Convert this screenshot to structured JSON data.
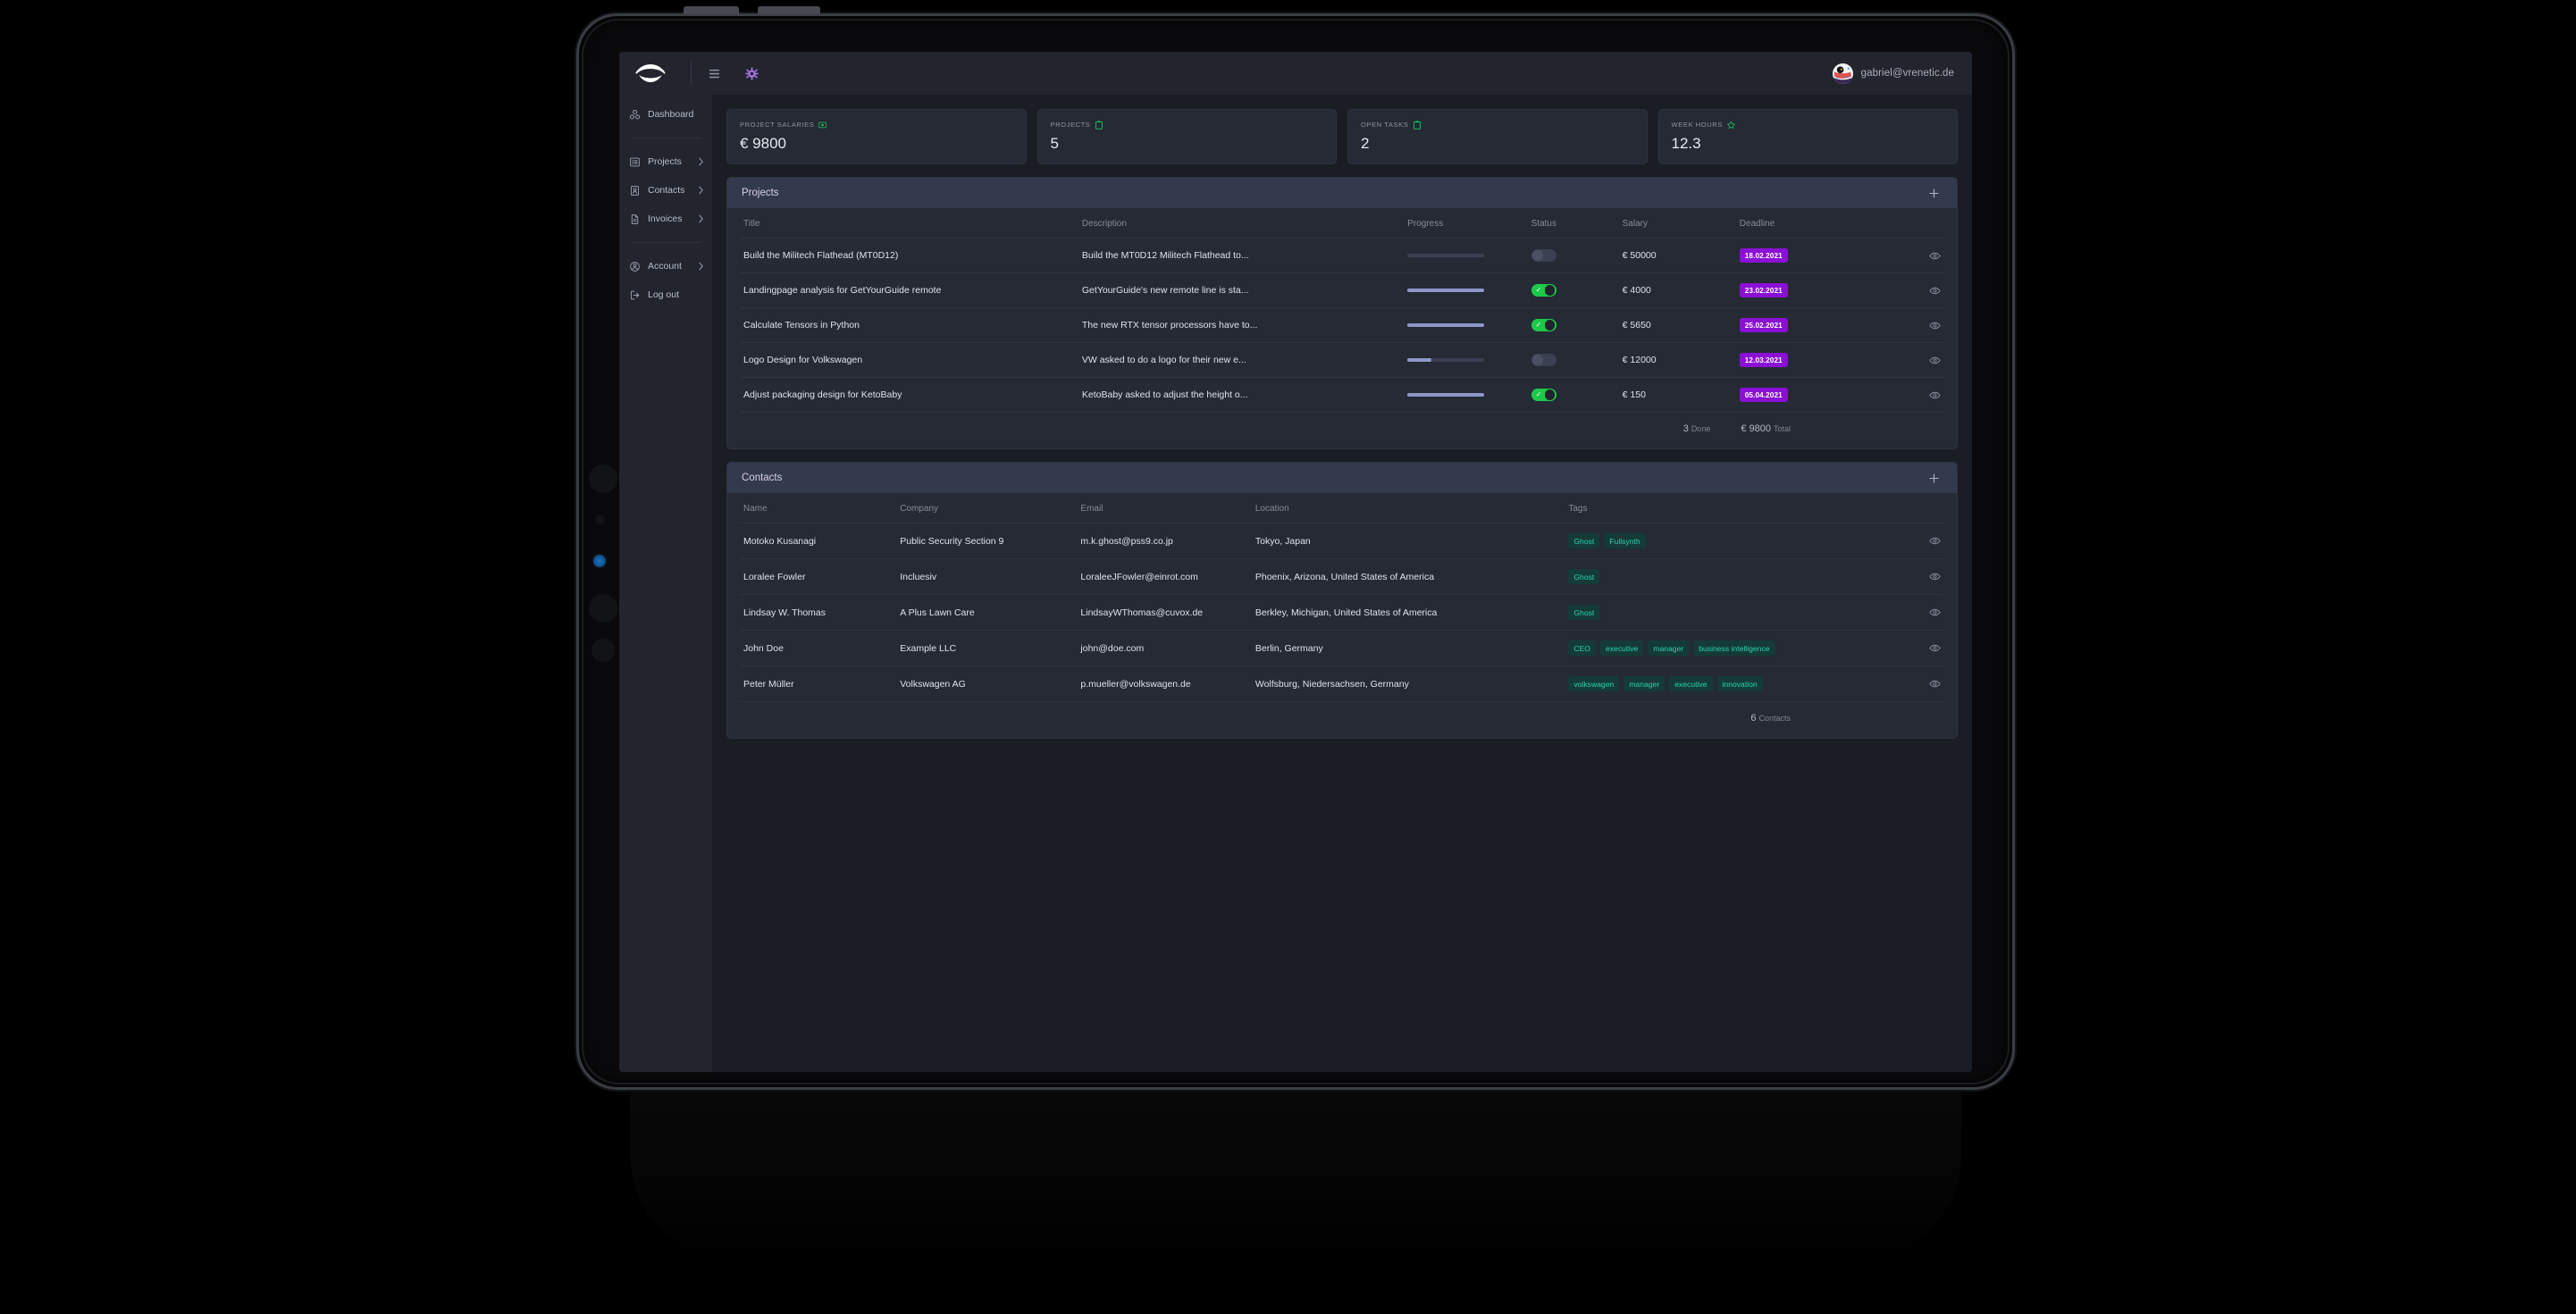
{
  "topbar": {
    "logo_icon": "eye-lens-logo",
    "menu_icon": "hamburger-menu-icon",
    "settings_icon": "gear-icon",
    "user_email": "gabriel@vrenetic.de",
    "avatar_icon": "user-avatar"
  },
  "sidebar": {
    "groups": [
      {
        "items": [
          {
            "label": "Dashboard",
            "icon": "dashboard-icon",
            "chevron": false
          }
        ]
      },
      {
        "items": [
          {
            "label": "Projects",
            "icon": "list-icon",
            "chevron": true
          },
          {
            "label": "Contacts",
            "icon": "contact-card-icon",
            "chevron": true
          },
          {
            "label": "Invoices",
            "icon": "document-icon",
            "chevron": true
          }
        ]
      },
      {
        "items": [
          {
            "label": "Account",
            "icon": "account-circle-icon",
            "chevron": true
          },
          {
            "label": "Log out",
            "icon": "logout-icon",
            "chevron": false
          }
        ]
      }
    ]
  },
  "stats": [
    {
      "label": "PROJECT SALARIES",
      "icon": "money-icon",
      "value": "€ 9800"
    },
    {
      "label": "PROJECTS",
      "icon": "clipboard-icon",
      "value": "5"
    },
    {
      "label": "OPEN TASKS",
      "icon": "clipboard-icon",
      "value": "2"
    },
    {
      "label": "WEEK HOURS",
      "icon": "star-icon",
      "value": "12.3"
    }
  ],
  "projects_panel": {
    "title": "Projects",
    "add_label": "+",
    "columns": [
      "Title",
      "Description",
      "Progress",
      "Status",
      "Salary",
      "Deadline",
      ""
    ],
    "rows": [
      {
        "title": "Build the Militech Flathead (MT0D12)",
        "description": "Build the MT0D12 Militech Flathead to...",
        "progress": 0,
        "status": false,
        "salary": "€ 50000",
        "deadline": "18.02.2021",
        "action_icon": "eye-icon"
      },
      {
        "title": "Landingpage analysis for GetYourGuide remote",
        "description": "GetYourGuide's new remote line is sta...",
        "progress": 100,
        "status": true,
        "salary": "€ 4000",
        "deadline": "23.02.2021",
        "action_icon": "eye-icon"
      },
      {
        "title": "Calculate Tensors in Python",
        "description": "The new RTX tensor processors have to...",
        "progress": 100,
        "status": true,
        "salary": "€ 5650",
        "deadline": "25.02.2021",
        "action_icon": "eye-icon"
      },
      {
        "title": "Logo Design for Volkswagen",
        "description": "VW asked to do a logo for their new e...",
        "progress": 31,
        "status": false,
        "salary": "€ 12000",
        "deadline": "12.03.2021",
        "action_icon": "eye-icon"
      },
      {
        "title": "Adjust packaging design for KetoBaby",
        "description": "KetoBaby asked to adjust the height o...",
        "progress": 100,
        "status": true,
        "salary": "€ 150",
        "deadline": "05.04.2021",
        "action_icon": "eye-icon"
      }
    ],
    "footer": {
      "done_value": "3",
      "done_label": "Done",
      "total_value": "€ 9800",
      "total_label": "Total"
    }
  },
  "contacts_panel": {
    "title": "Contacts",
    "add_label": "+",
    "columns": [
      "Name",
      "Company",
      "Email",
      "Location",
      "Tags",
      ""
    ],
    "rows": [
      {
        "name": "Motoko Kusanagi",
        "company": "Public Security Section 9",
        "email": "m.k.ghost@pss9.co.jp",
        "location": "Tokyo, Japan",
        "tags": [
          "Ghost",
          "Fullsynth"
        ],
        "action_icon": "eye-icon"
      },
      {
        "name": "Loralee Fowler",
        "company": "Incluesiv",
        "email": "LoraleeJFowler@einrot.com",
        "location": "Phoenix, Arizona, United States of America",
        "tags": [
          "Ghost"
        ],
        "action_icon": "eye-icon"
      },
      {
        "name": "Lindsay W. Thomas",
        "company": "A Plus Lawn Care",
        "email": "LindsayWThomas@cuvox.de",
        "location": "Berkley, Michigan, United States of America",
        "tags": [
          "Ghost"
        ],
        "action_icon": "eye-icon"
      },
      {
        "name": "John Doe",
        "company": "Example LLC",
        "email": "john@doe.com",
        "location": "Berlin, Germany",
        "tags": [
          "CEO",
          "executive",
          "manager",
          "business intelligence"
        ],
        "action_icon": "eye-icon"
      },
      {
        "name": "Peter Müller",
        "company": "Volkswagen AG",
        "email": "p.mueller@volkswagen.de",
        "location": "Wolfsburg, Niedersachsen, Germany",
        "tags": [
          "volkswagen",
          "manager",
          "executive",
          "innovation"
        ],
        "action_icon": "eye-icon"
      }
    ],
    "footer": {
      "count_value": "6",
      "count_label": "Contacts"
    }
  },
  "colors": {
    "accent_purple": "#b9a4e0",
    "badge_purple": "#8b10d6",
    "toggle_green": "#1ec94a",
    "tag_teal": "#2ad3b0",
    "progress_fill": "#8e96c9",
    "panel_header": "#343a4d",
    "card_bg": "#252a35",
    "page_bg": "#1a1d24"
  }
}
